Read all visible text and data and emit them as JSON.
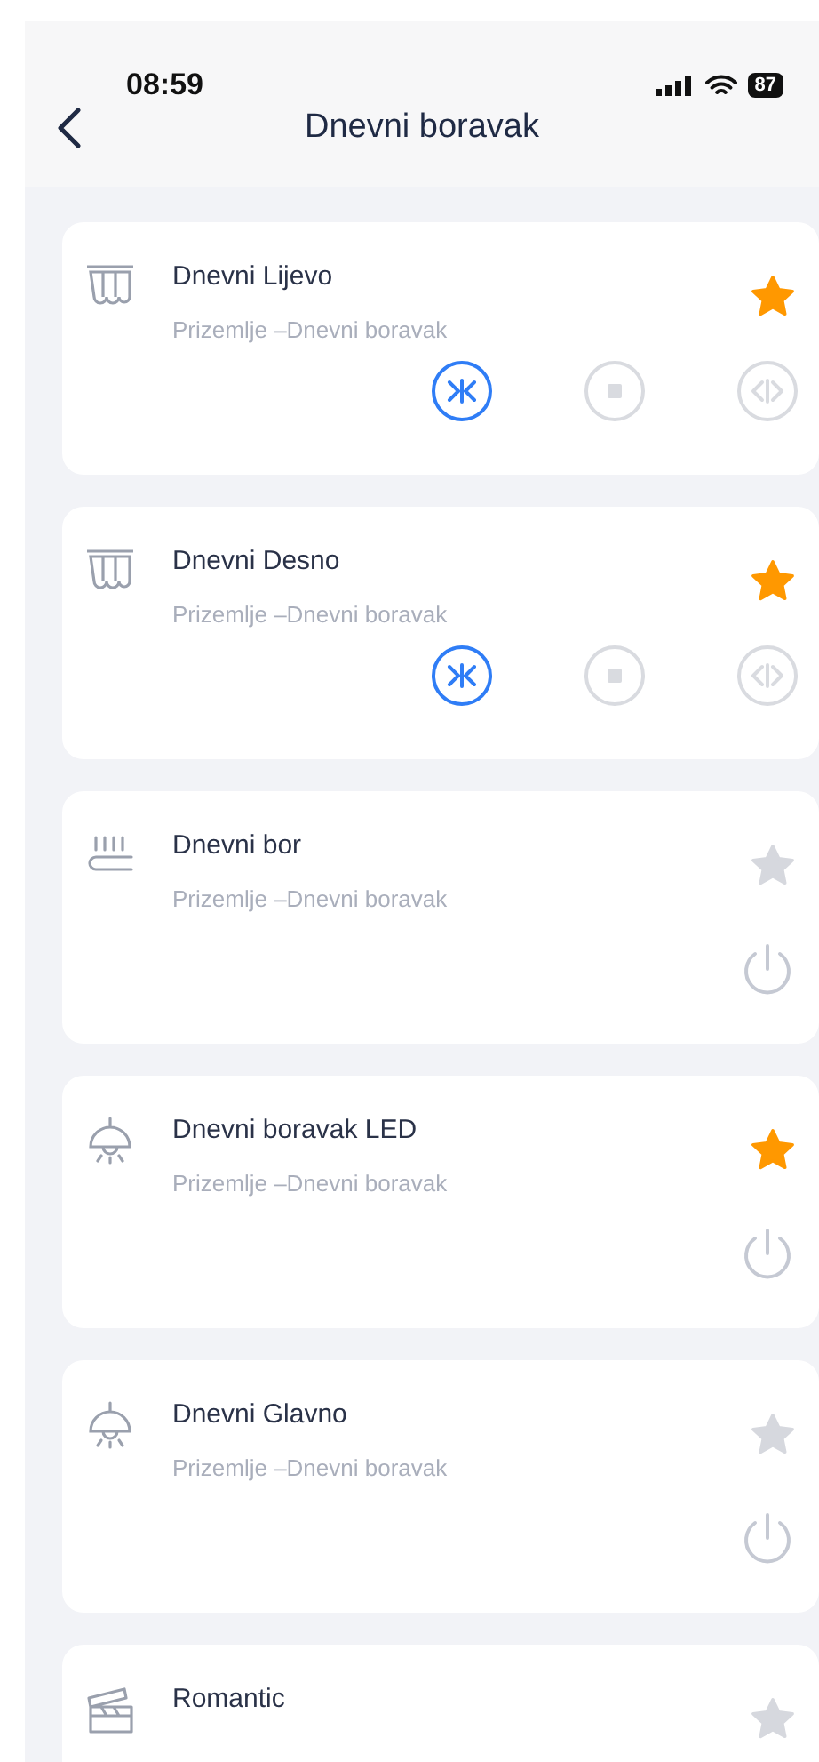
{
  "status_bar": {
    "time": "08:59",
    "battery": "87"
  },
  "header": {
    "title": "Dnevni boravak"
  },
  "devices": [
    {
      "kind": "curtain",
      "name": "Dnevni Lijevo",
      "location": "Prizemlje –Dnevni boravak",
      "favorite": true,
      "controls": [
        {
          "selected": true
        },
        {
          "selected": false
        },
        {
          "selected": false
        }
      ]
    },
    {
      "kind": "curtain",
      "name": "Dnevni Desno",
      "location": "Prizemlje –Dnevni boravak",
      "favorite": true,
      "controls": [
        {
          "selected": true
        },
        {
          "selected": false
        },
        {
          "selected": false
        }
      ]
    },
    {
      "kind": "heater",
      "name": "Dnevni bor",
      "location": "Prizemlje –Dnevni boravak",
      "favorite": false,
      "on": false
    },
    {
      "kind": "lamp",
      "name": "Dnevni boravak LED",
      "location": "Prizemlje –Dnevni boravak",
      "favorite": true,
      "on": false
    },
    {
      "kind": "lamp",
      "name": "Dnevni Glavno",
      "location": "Prizemlje –Dnevni boravak",
      "favorite": false,
      "on": false
    },
    {
      "kind": "scene",
      "name": "Romantic",
      "favorite": false
    }
  ]
}
